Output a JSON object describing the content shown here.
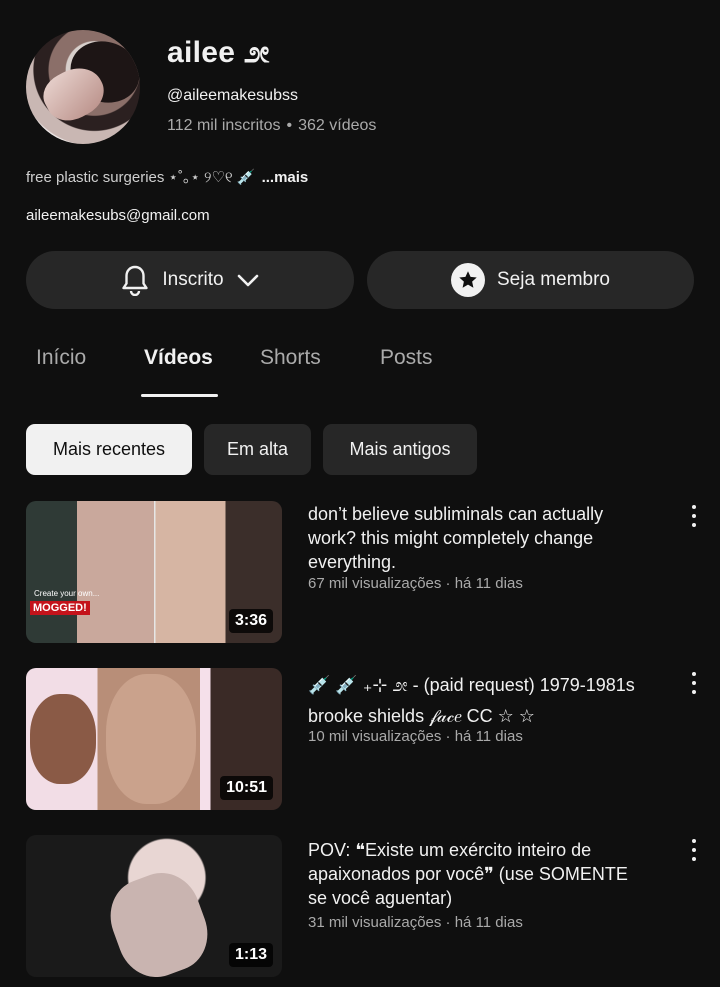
{
  "channel": {
    "name": "ailee ೨ೕ",
    "handle": "@aileemakesubss",
    "subscribers": "112 mil inscritos",
    "videos_count": "362 vídeos",
    "description": "free plastic surgeries ⋆˚｡⋆ ୨♡୧ 💉",
    "more_label": "...mais",
    "email": "aileemakesubs@gmail.com"
  },
  "buttons": {
    "subscribed_label": "Inscrito",
    "member_label": "Seja membro"
  },
  "tabs": [
    {
      "label": "Início",
      "active": false
    },
    {
      "label": "Vídeos",
      "active": true
    },
    {
      "label": "Shorts",
      "active": false
    },
    {
      "label": "Posts",
      "active": false
    }
  ],
  "chips": [
    {
      "label": "Mais recentes",
      "selected": true
    },
    {
      "label": "Em alta",
      "selected": false
    },
    {
      "label": "Mais antigos",
      "selected": false
    }
  ],
  "videos": [
    {
      "title_lines": [
        "don’t believe subliminals can actually",
        "work? this might completely change",
        "everything."
      ],
      "meta": "67 mil visualizações · há 11 dias",
      "duration": "3:36",
      "thumb_text_1": "Create your own...",
      "thumb_text_2": "MOGGED!"
    },
    {
      "title_lines": [
        "💉 💉 ₊⊹ ೨ೕ ‐ (paid request) 1979-1981s",
        "brooke shields 𝒻𝒶𝒸𝑒 CC ☆ ☆"
      ],
      "meta": "10 mil visualizações · há 11 dias",
      "duration": "10:51"
    },
    {
      "title_lines": [
        "POV: ❝Existe um exército inteiro de",
        "apaixonados por você❞ (use SOMENTE",
        "se você aguentar)"
      ],
      "meta": "31 mil visualizações · há 11 dias",
      "duration": "1:13"
    }
  ],
  "colors": {
    "background": "#0f0f0f",
    "surface": "#272727",
    "text_primary": "#f1f1f1",
    "text_secondary": "#aaaaaa"
  }
}
